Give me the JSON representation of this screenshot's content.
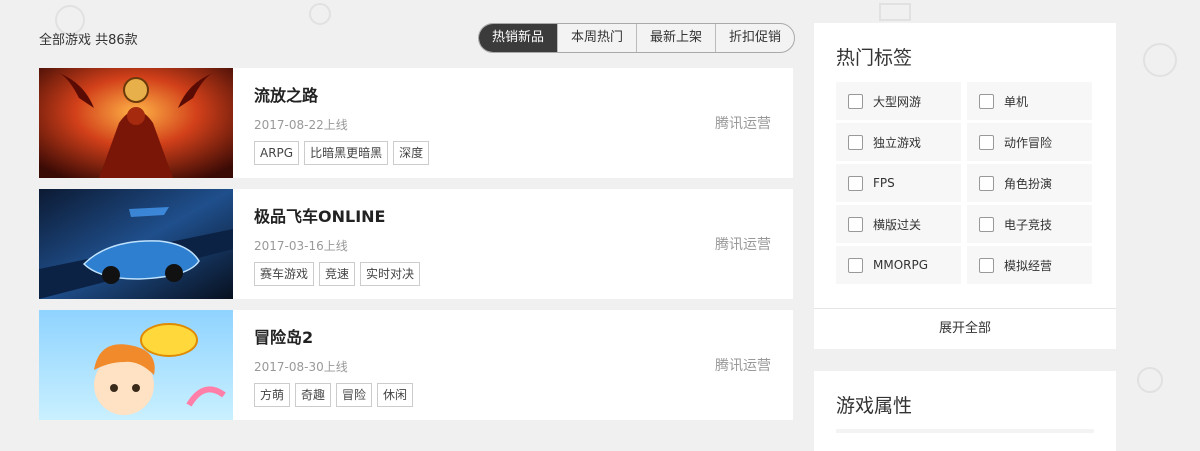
{
  "summary": {
    "count_text": "全部游戏 共86款"
  },
  "sort_tabs": [
    {
      "label": "热销新品",
      "active": true
    },
    {
      "label": "本周热门",
      "active": false
    },
    {
      "label": "最新上架",
      "active": false
    },
    {
      "label": "折扣促销",
      "active": false
    }
  ],
  "games": [
    {
      "name": "流放之路",
      "date": "2017-08-22上线",
      "publisher": "腾讯运营",
      "tags": [
        "ARPG",
        "比暗黑更暗黑",
        "深度"
      ]
    },
    {
      "name": "极品飞车ONLINE",
      "date": "2017-03-16上线",
      "publisher": "腾讯运营",
      "tags": [
        "赛车游戏",
        "竞速",
        "实时对决"
      ]
    },
    {
      "name": "冒险岛2",
      "date": "2017-08-30上线",
      "publisher": "腾讯运营",
      "tags": [
        "方萌",
        "奇趣",
        "冒险",
        "休闲"
      ]
    }
  ],
  "hot_tags": {
    "title": "热门标签",
    "items": [
      "大型网游",
      "单机",
      "独立游戏",
      "动作冒险",
      "FPS",
      "角色扮演",
      "横版过关",
      "电子竞技",
      "MMORPG",
      "模拟经营"
    ],
    "expand_label": "展开全部"
  },
  "attributes": {
    "title": "游戏属性"
  },
  "colors": {
    "active_tab_bg": "#3b3b3b",
    "page_bg": "#f0f0f0",
    "card_bg": "#ffffff"
  }
}
